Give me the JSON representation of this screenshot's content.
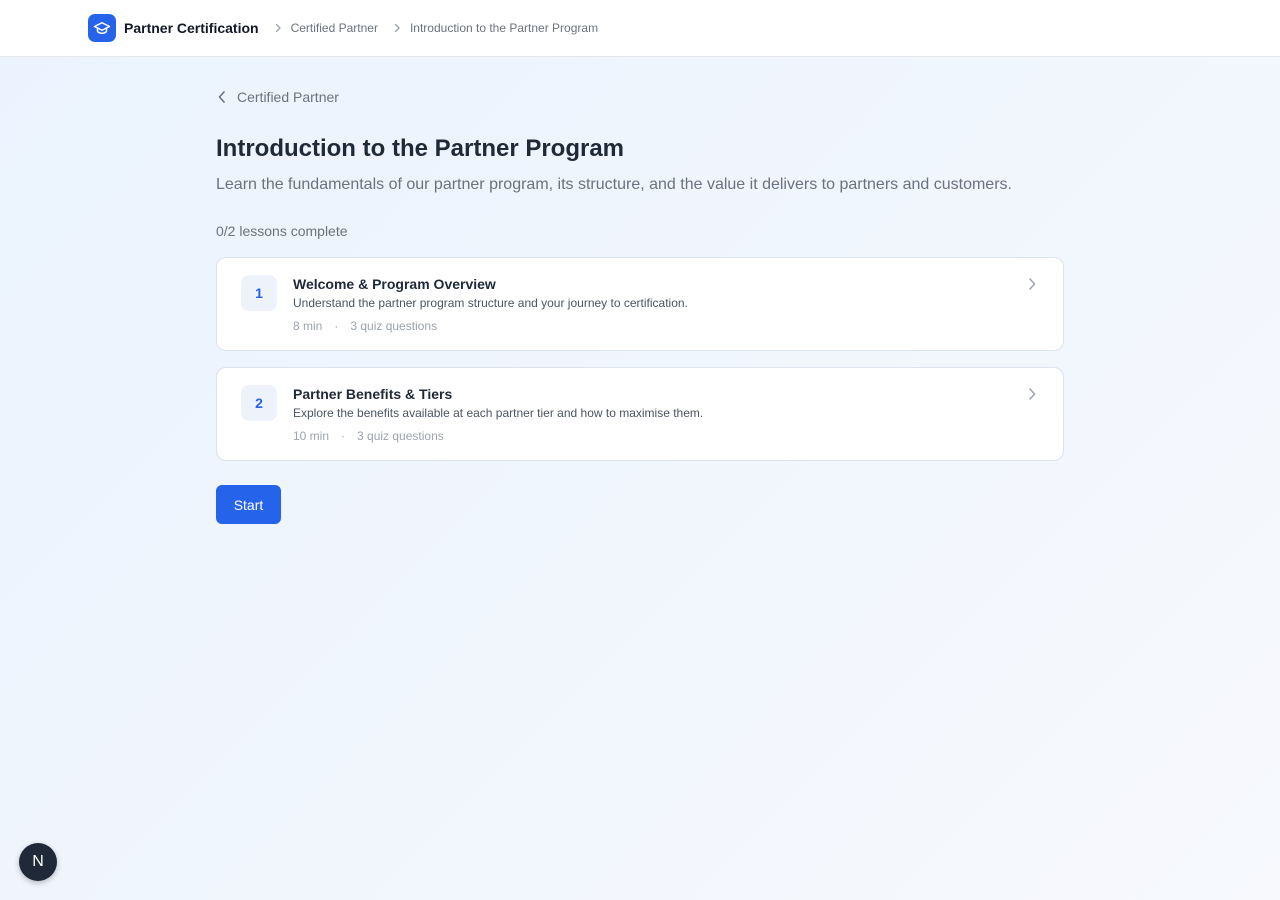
{
  "header": {
    "brand_name": "Partner Certification",
    "logo_icon": "graduation-cap-icon",
    "breadcrumbs": [
      "Certified Partner",
      "Introduction to the Partner Program"
    ]
  },
  "back_link": {
    "label": "Certified Partner"
  },
  "module": {
    "title": "Introduction to the Partner Program",
    "description": "Learn the fundamentals of our partner program, its structure, and the value it delivers to partners and customers.",
    "progress": "0/2 lessons complete"
  },
  "lessons": [
    {
      "number": "1",
      "title": "Welcome & Program Overview",
      "description": "Understand the partner program structure and your journey to certification.",
      "duration": "8 min",
      "separator": "·",
      "quiz": "3 quiz questions"
    },
    {
      "number": "2",
      "title": "Partner Benefits & Tiers",
      "description": "Explore the benefits available at each partner tier and how to maximise them.",
      "duration": "10 min",
      "separator": "·",
      "quiz": "3 quiz questions"
    }
  ],
  "start_button": {
    "label": "Start"
  },
  "dev_badge": {
    "label": "N"
  },
  "colors": {
    "accent": "#2563eb",
    "title": "#1f2937",
    "muted": "#6b7280"
  }
}
